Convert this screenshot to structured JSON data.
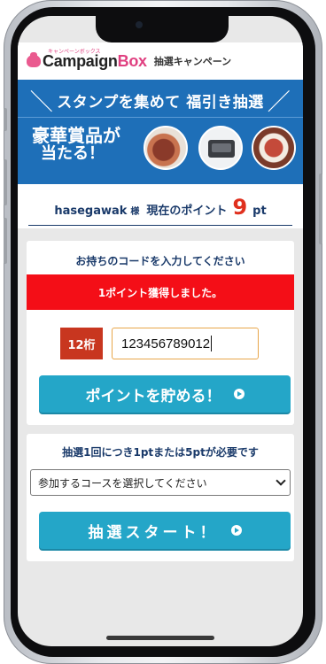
{
  "header": {
    "logo_kana": "キャンペーンボックス",
    "logo_main": "Campaign",
    "logo_box": "Box",
    "subtitle": "抽選キャンペーン"
  },
  "banner": {
    "headline": "スタンプを集めて 福引き抽選",
    "prize_line1": "豪華賞品が",
    "prize_line2": "当たる！"
  },
  "points": {
    "username": "hasegawak",
    "honorific": "様",
    "label": "現在のポイント",
    "value": "9",
    "unit": "pt"
  },
  "code_card": {
    "title": "お持ちのコードを入力してください",
    "alert": "1ポイント獲得しました。",
    "digits_badge": "12桁",
    "code_value": "123456789012",
    "submit_label": "ポイントを貯める！"
  },
  "lottery_card": {
    "title": "抽選1回につき1ptまたは5ptが必要です",
    "course_select": "参加するコースを選択してください",
    "start_label": "抽選スタート！"
  },
  "colors": {
    "accent_button": "#24a6c8",
    "alert_red": "#f40e17",
    "badge_red": "#c8361f",
    "banner_blue": "#1e6fb8",
    "points_red": "#e0301e"
  },
  "icons": [
    "logo-pig-icon",
    "play-circle-icon",
    "chevron-down-icon"
  ]
}
